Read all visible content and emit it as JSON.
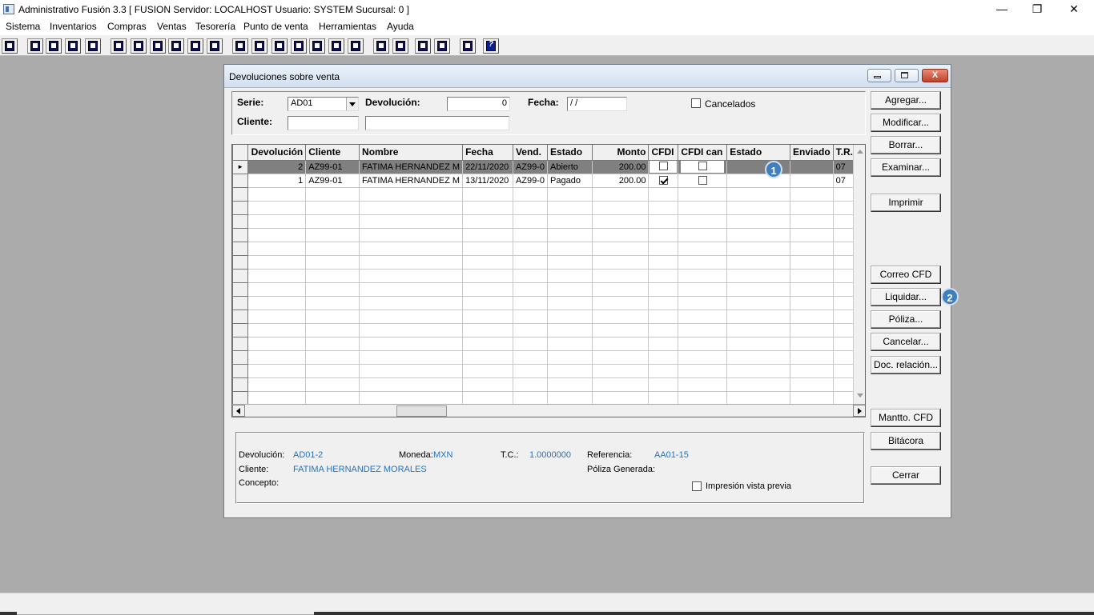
{
  "window": {
    "title": "Administrativo Fusión 3.3 [ FUSION   Servidor: LOCALHOST   Usuario: SYSTEM    Sucursal: 0 ]",
    "controls": [
      "—",
      "❐",
      "✕"
    ]
  },
  "menu": [
    "Sistema",
    "Inventarios",
    "Compras",
    "Ventas",
    "Tesorería",
    "Punto de venta",
    "Herramientas",
    "Ayuda"
  ],
  "toolbar_icons": [
    "calculator-icon",
    "copy-icon",
    "clipboard-icon",
    "transfer-icon",
    "find-icon",
    "user-icon",
    "folder-icon",
    "print-icon",
    "print-preview-icon",
    "document-icon",
    "list-icon",
    "people-icon",
    "window-icon",
    "export-icon",
    "add-icon",
    "money-icon",
    "report-icon",
    "table-icon",
    "home-icon",
    "zoom-icon",
    "refresh-icon",
    "undo-icon",
    "back-icon",
    "help-icon"
  ],
  "dialog": {
    "title": "Devoluciones sobre venta",
    "close_glyph": "X",
    "filters": {
      "serie_label": "Serie:",
      "serie_value": "AD01",
      "devolucion_label": "Devolución:",
      "devolucion_value": "0",
      "fecha_label": "Fecha:",
      "fecha_value": " / /",
      "cancelados_label": "Cancelados",
      "cliente_label": "Cliente:",
      "cliente_code": "",
      "cliente_name": ""
    },
    "grid": {
      "columns": [
        "Devolución",
        "Cliente",
        "Nombre",
        "Fecha",
        "Vend.",
        "Estado",
        "Monto",
        "CFDI",
        "CFDI can",
        "Estado",
        "Enviado",
        "T.R."
      ],
      "rows": [
        {
          "devolucion": "2",
          "cliente": "AZ99-01",
          "nombre": "FATIMA HERNANDEZ M",
          "fecha": "22/11/2020",
          "vend": "AZ99-0",
          "estado": "Abierto",
          "monto": "200.00",
          "cfdi": false,
          "cfdi_can": false,
          "estado2": "",
          "enviado": "",
          "tr": "07",
          "selected": true
        },
        {
          "devolucion": "1",
          "cliente": "AZ99-01",
          "nombre": "FATIMA HERNANDEZ M",
          "fecha": "13/11/2020",
          "vend": "AZ99-0",
          "estado": "Pagado",
          "monto": "200.00",
          "cfdi": true,
          "cfdi_can": false,
          "estado2": "",
          "enviado": "",
          "tr": "07",
          "selected": false
        }
      ],
      "empty_rows": 17
    },
    "details": {
      "devolucion_label": "Devolución:",
      "devolucion_value": "AD01-2",
      "moneda_label": "Moneda:",
      "moneda_value": "MXN",
      "tc_label": "T.C.:",
      "tc_value": "1.0000000",
      "referencia_label": "Referencia:",
      "referencia_value": "AA01-15",
      "cliente_label": "Cliente:",
      "cliente_value": "FATIMA HERNANDEZ MORALES",
      "poliza_label": "Póliza Generada:",
      "concepto_label": "Concepto:",
      "vista_previa_label": "Impresión vista previa"
    },
    "buttons": {
      "agregar": "Agregar...",
      "modificar": "Modificar...",
      "borrar": "Borrar...",
      "examinar": "Examinar...",
      "imprimir": "Imprimir",
      "correo_cfd": "Correo CFD",
      "liquidar": "Liquidar...",
      "poliza": "Póliza...",
      "cancelar": "Cancelar...",
      "doc_relacion": "Doc. relación...",
      "mantto_cfd": "Mantto. CFD",
      "bitacora": "Bitácora",
      "cerrar": "Cerrar"
    },
    "badges": [
      "1",
      "2"
    ]
  }
}
